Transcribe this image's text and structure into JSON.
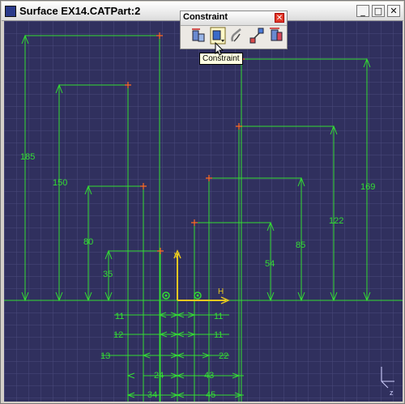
{
  "window": {
    "title": "Surface EX14.CATPart:2",
    "minimize_glyph": "_",
    "maximize_glyph": "□",
    "close_glyph": "✕"
  },
  "toolbar": {
    "title": "Constraint",
    "close_glyph": "✕",
    "tooltip": "Constraint",
    "buttons": [
      "constraints-defined-in-dialog-icon",
      "constraint-icon",
      "contact-constraint-icon",
      "fix-together-icon",
      "auto-constraint-icon"
    ]
  },
  "sketch": {
    "axis_v_label": "V",
    "axis_h_label": "H",
    "vertical_dims": [
      "185",
      "150",
      "80",
      "35",
      "169",
      "122",
      "85",
      "54"
    ],
    "horizontal_dims_left": [
      "11",
      "12",
      "13",
      "24",
      "34"
    ],
    "horizontal_dims_right": [
      "11",
      "11",
      "22",
      "43",
      "45"
    ]
  },
  "colors": {
    "background": "#30305e",
    "grid": "#4a4a7c",
    "dimension": "#33dd33",
    "point": "#ff6a20",
    "axis": "#e8c820"
  }
}
